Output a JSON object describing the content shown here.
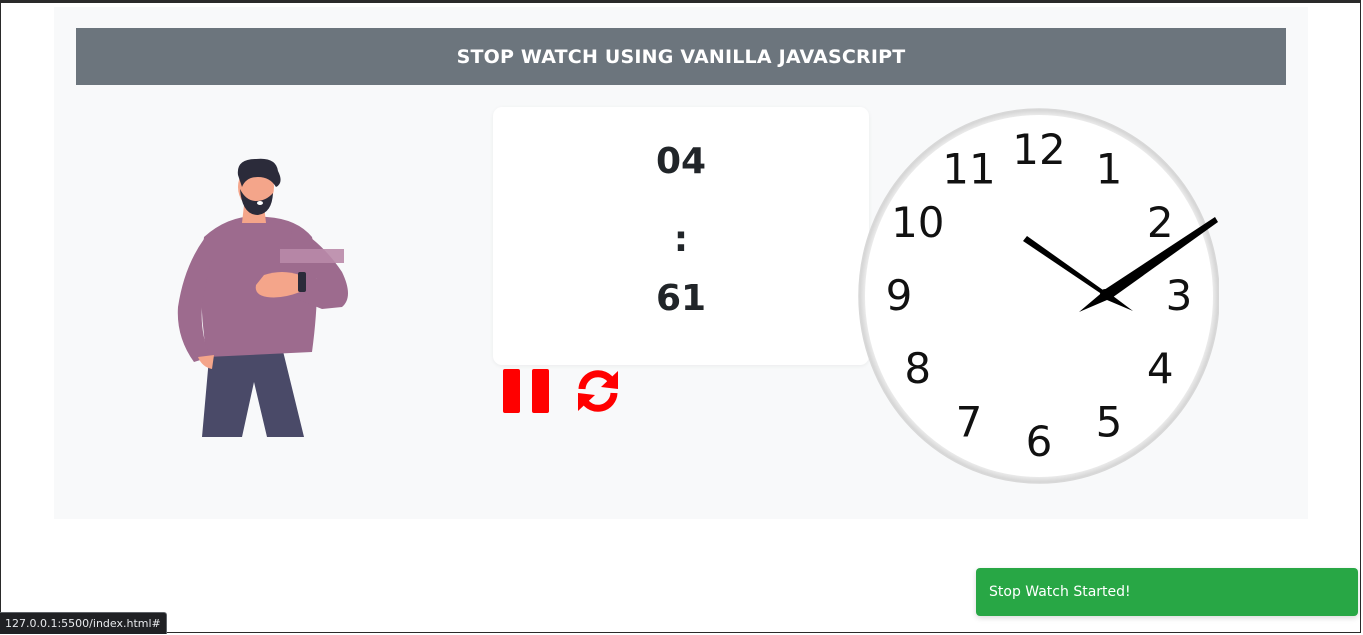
{
  "header": {
    "title": "STOP WATCH USING VANILLA JAVASCRIPT"
  },
  "timer": {
    "minutes": "04",
    "separator": ":",
    "seconds": "61"
  },
  "controls": {
    "pause_icon": "pause-icon",
    "reset_icon": "refresh-icon",
    "icon_color": "#ff0000"
  },
  "clock": {
    "numerals": [
      "12",
      "1",
      "2",
      "3",
      "4",
      "5",
      "6",
      "7",
      "8",
      "9",
      "10",
      "11"
    ]
  },
  "toast": {
    "message": "Stop Watch Started!",
    "color": "#28a745"
  },
  "status_bar": {
    "url": "127.0.0.1:5500/index.html#"
  },
  "colors": {
    "title_bar": "#6c757d",
    "background": "#f8f9fa"
  }
}
